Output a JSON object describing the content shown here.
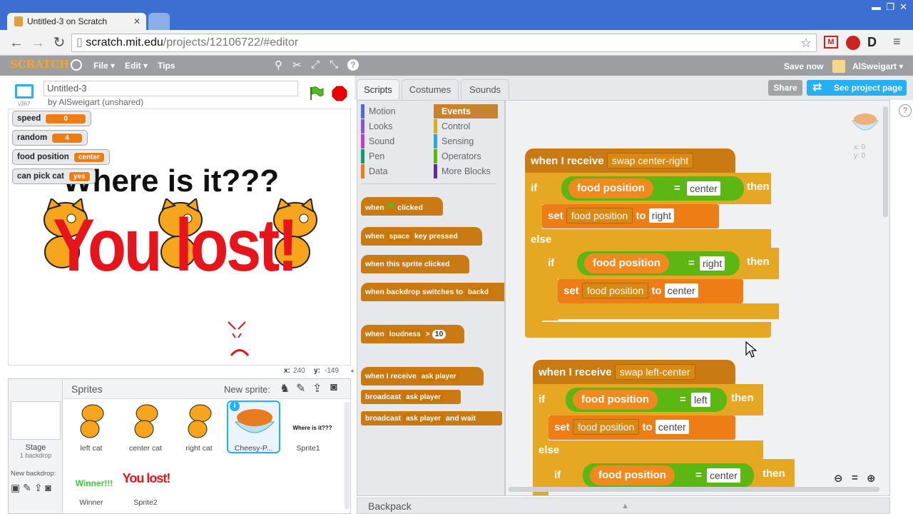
{
  "browser": {
    "tab_title": "Untitled-3 on Scratch",
    "url_host": "scratch.mit.edu",
    "url_path": "/projects/12106722/#editor"
  },
  "menu": {
    "logo": "SCRATCH",
    "file": "File ▾",
    "edit": "Edit ▾",
    "tips": "Tips",
    "save_now": "Save now",
    "user": "AlSweigart ▾"
  },
  "project": {
    "title": "Untitled-3",
    "author": "by AlSweigart (unshared)",
    "version": "v367"
  },
  "monitors": [
    {
      "name": "speed",
      "value": "0"
    },
    {
      "name": "random",
      "value": "4"
    },
    {
      "name": "food position",
      "value": "center"
    },
    {
      "name": "can pick cat",
      "value": "yes"
    }
  ],
  "stage": {
    "heading": "Where is it???",
    "lost_text": "You lost!",
    "coords_x_label": "x:",
    "coords_x": "240",
    "coords_y_label": "y:",
    "coords_y": "-149"
  },
  "sprites_pane": {
    "title": "Sprites",
    "new_sprite": "New sprite:",
    "stage_label": "Stage",
    "stage_sub": "1 backdrop",
    "new_backdrop": "New backdrop:",
    "sprites": [
      {
        "name": "left cat"
      },
      {
        "name": "center cat"
      },
      {
        "name": "right cat"
      },
      {
        "name": "Cheesy-P..."
      },
      {
        "name": "Sprite1",
        "thumb_text": "Where is it???"
      },
      {
        "name": "Winner",
        "thumb_text": "Winner!!!"
      },
      {
        "name": "Sprite2",
        "thumb_text": "You lost!"
      }
    ]
  },
  "tabs": {
    "scripts": "Scripts",
    "costumes": "Costumes",
    "sounds": "Sounds"
  },
  "top_buttons": {
    "share": "Share",
    "see_project": "See project page"
  },
  "categories": [
    {
      "label": "Motion",
      "color": "#4a6cd4"
    },
    {
      "label": "Events",
      "color": "#c88330"
    },
    {
      "label": "Looks",
      "color": "#8a55d7"
    },
    {
      "label": "Control",
      "color": "#e1a91a"
    },
    {
      "label": "Sound",
      "color": "#bb42c3"
    },
    {
      "label": "Sensing",
      "color": "#2ca5e2"
    },
    {
      "label": "Pen",
      "color": "#0e9a6c"
    },
    {
      "label": "Operators",
      "color": "#5cb712"
    },
    {
      "label": "Data",
      "color": "#ee7d16"
    },
    {
      "label": "More Blocks",
      "color": "#632d99"
    }
  ],
  "palette_blocks": {
    "b1_a": "when",
    "b1_b": "clicked",
    "b2_a": "when",
    "b2_drop": "space",
    "b2_b": "key pressed",
    "b3": "when this sprite clicked",
    "b4_a": "when backdrop switches to",
    "b4_drop": "backd",
    "b5_a": "when",
    "b5_drop": "loudness",
    "b5_op": ">",
    "b5_val": "10",
    "b6_a": "when I receive",
    "b6_drop": "ask player",
    "b7_a": "broadcast",
    "b7_drop": "ask player",
    "b8_a": "broadcast",
    "b8_drop": "ask player",
    "b8_b": "and wait"
  },
  "script1": {
    "hat": "when I receive",
    "hat_msg": "swap center-right",
    "if1": "if",
    "var1": "food position",
    "eq1": "=",
    "val1": "center",
    "then1": "then",
    "set1": "set",
    "set1_var": "food position",
    "to1": "to",
    "set1_val": "right",
    "else1": "else",
    "if2": "if",
    "var2": "food position",
    "eq2": "=",
    "val2": "right",
    "then2": "then",
    "set2": "set",
    "set2_var": "food position",
    "to2": "to",
    "set2_val": "center"
  },
  "script2": {
    "hat": "when I receive",
    "hat_msg": "swap left-center",
    "if1": "if",
    "var1": "food position",
    "eq1": "=",
    "val1": "left",
    "then1": "then",
    "set1": "set",
    "set1_var": "food position",
    "to1": "to",
    "set1_val": "center",
    "else1": "else",
    "if2": "if",
    "var2": "food position",
    "eq2": "=",
    "val2": "center",
    "then2": "then"
  },
  "sprite_info": {
    "x": "x: 0",
    "y": "y: 0"
  },
  "backpack": "Backpack"
}
